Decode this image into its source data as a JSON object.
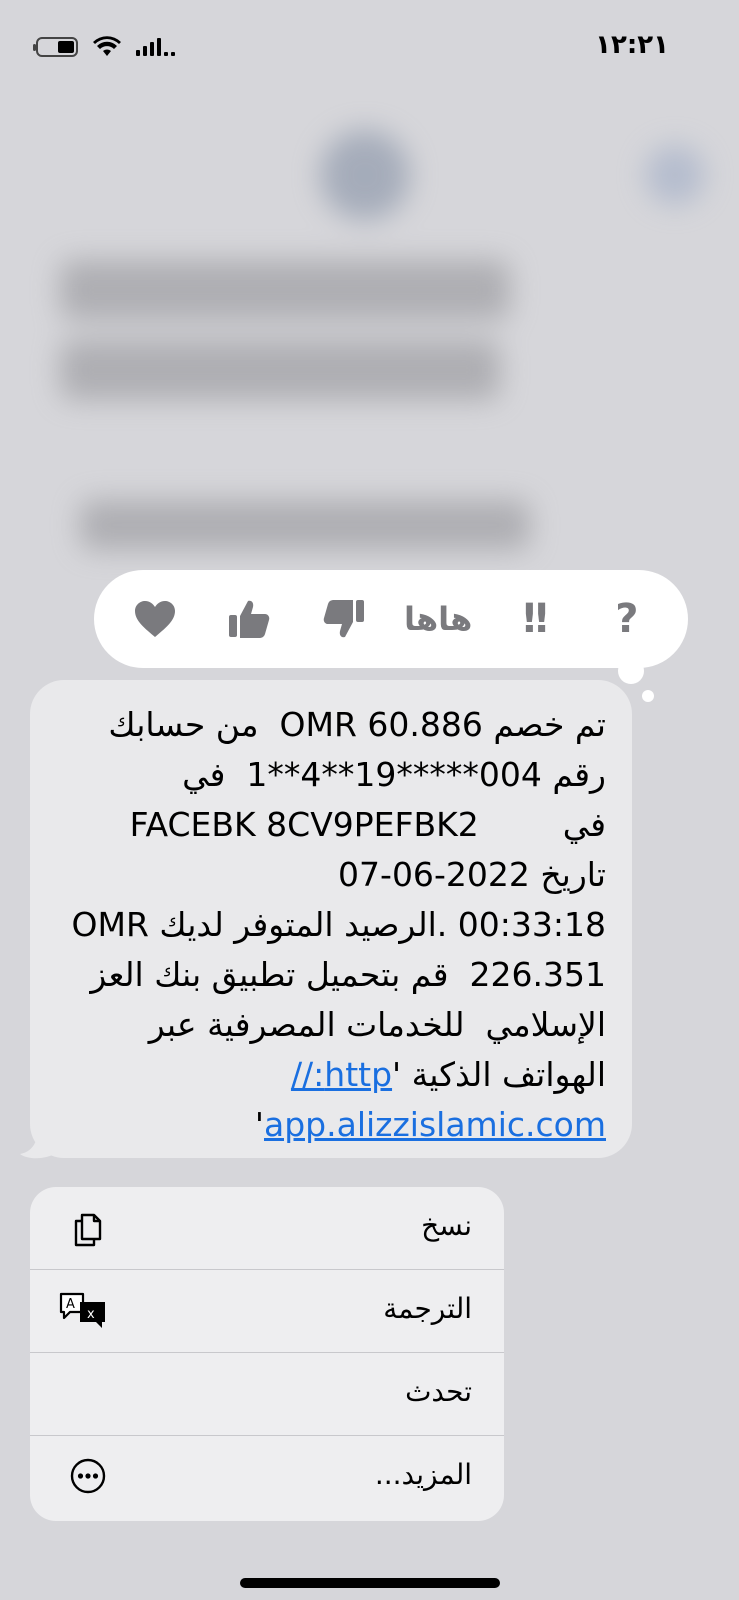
{
  "status_bar": {
    "time": "١٢:٢١"
  },
  "reactions": {
    "heart": "heart-icon",
    "thumbs_up": "thumbs-up-icon",
    "thumbs_down": "thumbs-down-icon",
    "haha_label": "هاها",
    "emphasize_label": "!!",
    "question_label": "?"
  },
  "message": {
    "lines": [
      "تم خصم OMR 60.886  من حسابك",
      "رقم 004*****19**4**1  في",
      "FACEBK 8CV9PEFBK2        في",
      "تاريخ 2022-06-07",
      "00:33:18 .الرصيد المتوفر لديك OMR",
      "226.351  قم بتحميل تطبيق بنك العز",
      "الإسلامي  للخدمات المصرفية عبر"
    ],
    "line8_text": "الهواتف الذكية '",
    "line8_link": "http://",
    "line9_link": "app.alizzislamic.com",
    "line9_suffix": "'"
  },
  "menu": {
    "items": [
      {
        "label": "نسخ",
        "icon": "copy-icon"
      },
      {
        "label": "الترجمة",
        "icon": "translate-icon"
      },
      {
        "label": "تحدث",
        "icon": ""
      },
      {
        "label": "المزيد...",
        "icon": "more-icon"
      }
    ]
  },
  "colors": {
    "link": "#1a6fe0",
    "bubble": "#e9e9eb",
    "background": "#d6d6da"
  }
}
